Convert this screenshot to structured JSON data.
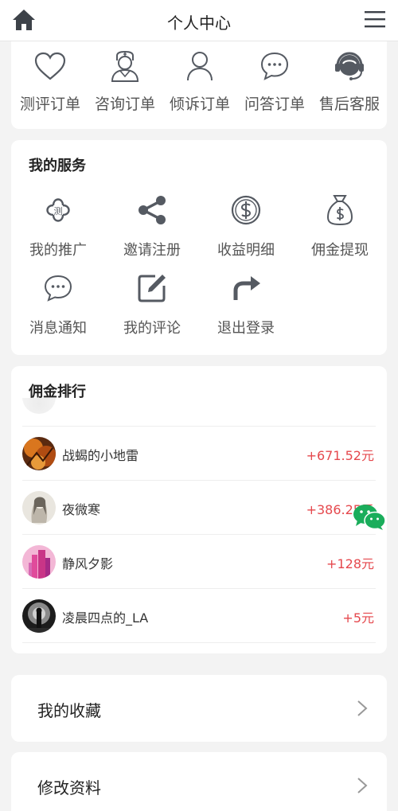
{
  "header": {
    "title": "个人中心",
    "home_icon": "home-icon",
    "menu_icon": "hamburger-menu-icon"
  },
  "orders": {
    "items": [
      {
        "label": "测评订单",
        "icon": "heart-icon"
      },
      {
        "label": "咨询订单",
        "icon": "doctor-icon"
      },
      {
        "label": "倾诉订单",
        "icon": "user-icon"
      },
      {
        "label": "问答订单",
        "icon": "chat-bubble-icon"
      },
      {
        "label": "售后客服",
        "icon": "headset-icon"
      }
    ]
  },
  "services": {
    "title": "我的服务",
    "items": [
      {
        "label": "我的推广",
        "icon": "clover-icon",
        "icon_text": "测"
      },
      {
        "label": "邀请注册",
        "icon": "share-icon"
      },
      {
        "label": "收益明细",
        "icon": "dollar-coin-icon"
      },
      {
        "label": "佣金提现",
        "icon": "money-bag-icon"
      },
      {
        "label": "消息通知",
        "icon": "message-icon"
      },
      {
        "label": "我的评论",
        "icon": "edit-icon"
      },
      {
        "label": "退出登录",
        "icon": "logout-arrow-icon"
      }
    ]
  },
  "ranking": {
    "title": "佣金排行",
    "rows": [
      {
        "name": "战蝎的小地雷",
        "amount": "+671.52元"
      },
      {
        "name": "夜微寒",
        "amount": "+386.25元"
      },
      {
        "name": "静风夕影",
        "amount": "+128元"
      },
      {
        "name": "凌晨四点的_LA",
        "amount": "+5元"
      }
    ]
  },
  "floating": {
    "icon": "wechat-icon"
  },
  "links": {
    "favorites": {
      "label": "我的收藏",
      "icon": "chevron-right-icon"
    },
    "edit_profile": {
      "label": "修改资料",
      "icon": "chevron-right-icon"
    }
  },
  "colors": {
    "accent_red": "#e5484d",
    "icon_gray": "#555a62",
    "wechat_green": "#1aad5b"
  }
}
